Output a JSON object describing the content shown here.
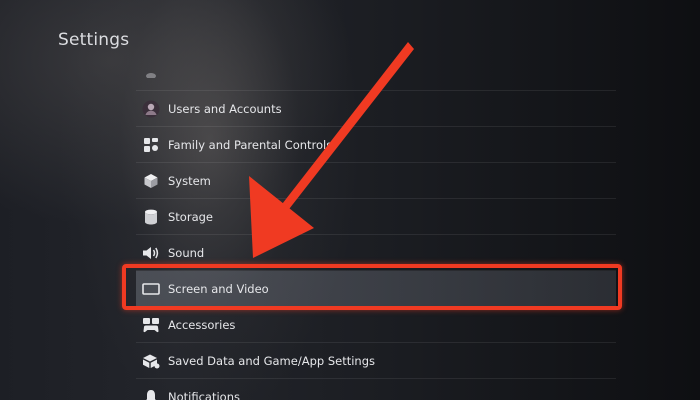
{
  "header": {
    "title": "Settings"
  },
  "menu": {
    "items": [
      {
        "label": "",
        "icon": "partial-icon",
        "state": "faded"
      },
      {
        "label": "Users and Accounts",
        "icon": "user-avatar-icon"
      },
      {
        "label": "Family and Parental Controls",
        "icon": "family-controls-icon"
      },
      {
        "label": "System",
        "icon": "system-cube-icon"
      },
      {
        "label": "Storage",
        "icon": "storage-icon"
      },
      {
        "label": "Sound",
        "icon": "speaker-icon"
      },
      {
        "label": "Screen and Video",
        "icon": "screen-icon",
        "state": "selected"
      },
      {
        "label": "Accessories",
        "icon": "controller-icon"
      },
      {
        "label": "Saved Data and Game/App Settings",
        "icon": "saved-data-icon"
      },
      {
        "label": "Notifications",
        "icon": "bell-icon"
      }
    ]
  },
  "annotation": {
    "color": "#f03a22",
    "target": "Screen and Video"
  }
}
